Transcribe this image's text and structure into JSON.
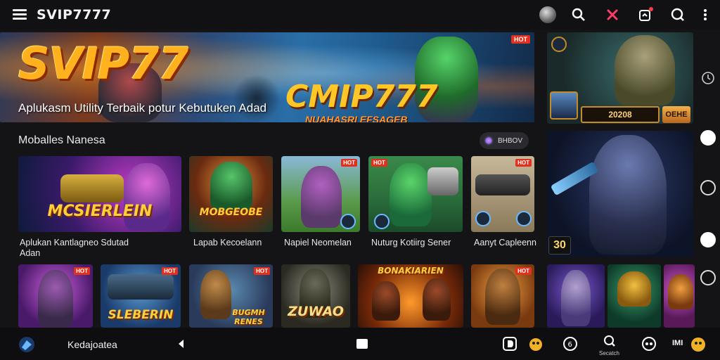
{
  "header": {
    "title": "SVIP7777",
    "icons": [
      "menu-icon",
      "avatar",
      "search-icon",
      "pin-icon",
      "notification-icon",
      "search-icon",
      "more-icon"
    ]
  },
  "hero": {
    "logo_left": "SVIP77",
    "logo_right": "CMIP777",
    "subtitle": "NUAHASRI EFSAGEB",
    "tagline": "Aplukasm Utility Terbaik potur Kebutuken Adad",
    "badge": "HOT"
  },
  "section": {
    "title": "Moballes Nanesa",
    "pill_label": "BHBOV"
  },
  "cards_row1": [
    {
      "logo": "MCSIERLEIN",
      "label_line1": "Aplukan Kantlagneo Sdutad",
      "label_line2": "Adan"
    },
    {
      "logo": "MOBGEOBE",
      "label_line1": "Lapab Kecoelann",
      "label_line2": "",
      "tag": ""
    },
    {
      "logo": "",
      "label_line1": "Napiel Neomelan",
      "label_line2": "",
      "tag": "HOT"
    },
    {
      "logo": "",
      "label_line1": "Nuturg Kotiirg Sener",
      "label_line2": "",
      "tag": "HOT"
    },
    {
      "logo": "",
      "label_line1": "Aanyt Capleenn",
      "label_line2": "",
      "tag": "HOT"
    }
  ],
  "cards_row2": [
    {
      "logo": "",
      "tag": "HOT"
    },
    {
      "logo": "SLEBERIN",
      "tag": "HOT"
    },
    {
      "logo": "BUGMH RENES",
      "tag": "HOT"
    },
    {
      "logo": "ZUWAO",
      "tag": ""
    },
    {
      "logo": "BONAKIARIEN",
      "tag": ""
    },
    {
      "logo": "",
      "tag": "HOT"
    }
  ],
  "side": {
    "score": "20208",
    "button": "OEHE",
    "number_badge": "30"
  },
  "bottom": {
    "label": "Kedajoatea",
    "search_caption": "Secatch",
    "profile_caption": "IMI"
  },
  "colors": {
    "background": "#141416",
    "accent_gold": "#ffb21e",
    "hot_red": "#e2301e"
  }
}
